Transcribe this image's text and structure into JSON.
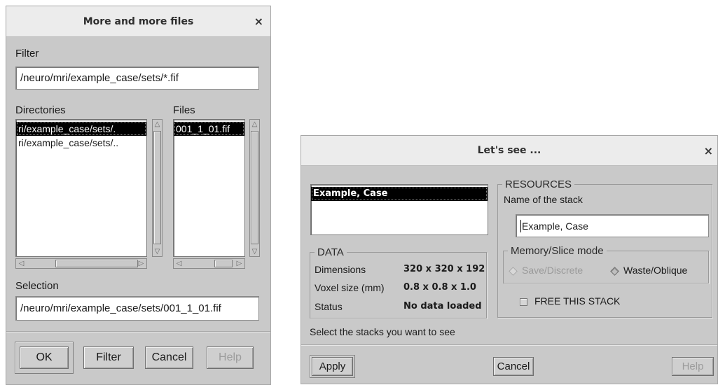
{
  "file_dialog": {
    "title": "More and more files",
    "filter_label": "Filter",
    "filter_value": "/neuro/mri/example_case/sets/*.fif",
    "directories_label": "Directories",
    "files_label": "Files",
    "directories": [
      "ri/example_case/sets/.",
      "ri/example_case/sets/.."
    ],
    "files": [
      "001_1_01.fif"
    ],
    "selection_label": "Selection",
    "selection_value": "/neuro/mri/example_case/sets/001_1_01.fif",
    "buttons": {
      "ok": "OK",
      "filter": "Filter",
      "cancel": "Cancel",
      "help": "Help"
    }
  },
  "stack_dialog": {
    "title": "Let's see ...",
    "stacks": [
      "Example, Case"
    ],
    "data_group": {
      "label": "DATA",
      "rows": [
        {
          "key": "Dimensions",
          "value": "320 x 320 x 192"
        },
        {
          "key": "Voxel size (mm)",
          "value": "0.8 x 0.8 x 1.0"
        },
        {
          "key": "Status",
          "value": "No data loaded"
        }
      ]
    },
    "resources": {
      "label": "RESOURCES",
      "name_label": "Name of the stack",
      "name_value": "Example, Case",
      "memory_group_label": "Memory/Slice mode",
      "mode_options": [
        "Save/Discrete",
        "Waste/Oblique"
      ],
      "selected_mode": "Waste/Oblique",
      "free_label": "FREE THIS STACK"
    },
    "hint": "Select the stacks you want to see",
    "buttons": {
      "apply": "Apply",
      "cancel": "Cancel",
      "help": "Help"
    }
  },
  "colors": {
    "dialog_bg": "#c9c9c9",
    "titlebar_bg": "#ececec",
    "selection_bg": "#000000",
    "selection_fg": "#ffffff"
  }
}
